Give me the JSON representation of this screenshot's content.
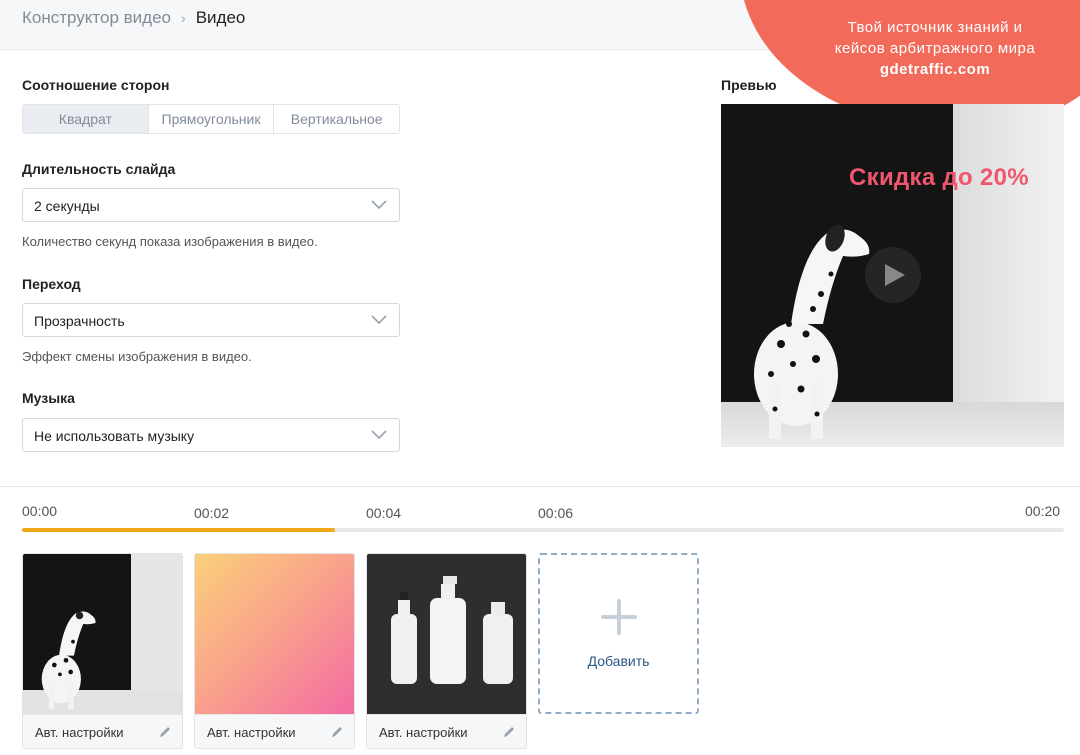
{
  "breadcrumb": {
    "parent": "Конструктор видео",
    "separator": "›",
    "current": "Видео"
  },
  "watermark": {
    "line1": "Твой источник знаний и",
    "line2": "кейсов арбитражного мира",
    "site": "gdetraffic.com"
  },
  "aspect": {
    "label": "Соотношение сторон",
    "options": [
      "Квадрат",
      "Прямоугольник",
      "Вертикальное"
    ],
    "selected": "Квадрат"
  },
  "slide_duration": {
    "label": "Длительность слайда",
    "value": "2 секунды",
    "hint": "Количество секунд показа изображения в видео."
  },
  "transition": {
    "label": "Переход",
    "value": "Прозрачность",
    "hint": "Эффект смены изображения в видео."
  },
  "music": {
    "label": "Музыка",
    "value": "Не использовать музыку"
  },
  "preview": {
    "label": "Превью",
    "promo_text": "Скидка до 20%"
  },
  "timeline": {
    "times": [
      "00:00",
      "00:02",
      "00:04",
      "00:06",
      "00:20"
    ],
    "progress_percent": 30
  },
  "slides": [
    {
      "label": "Авт. настройки",
      "image": "dalmatian"
    },
    {
      "label": "Авт. настройки",
      "image": "gradient"
    },
    {
      "label": "Авт. настройки",
      "image": "bottles"
    }
  ],
  "add_card": {
    "label": "Добавить"
  },
  "colors": {
    "accent_orange": "#f0a818",
    "link_blue": "#2a5885",
    "promo_pink": "#f0566d",
    "watermark": "#f26b5a"
  }
}
